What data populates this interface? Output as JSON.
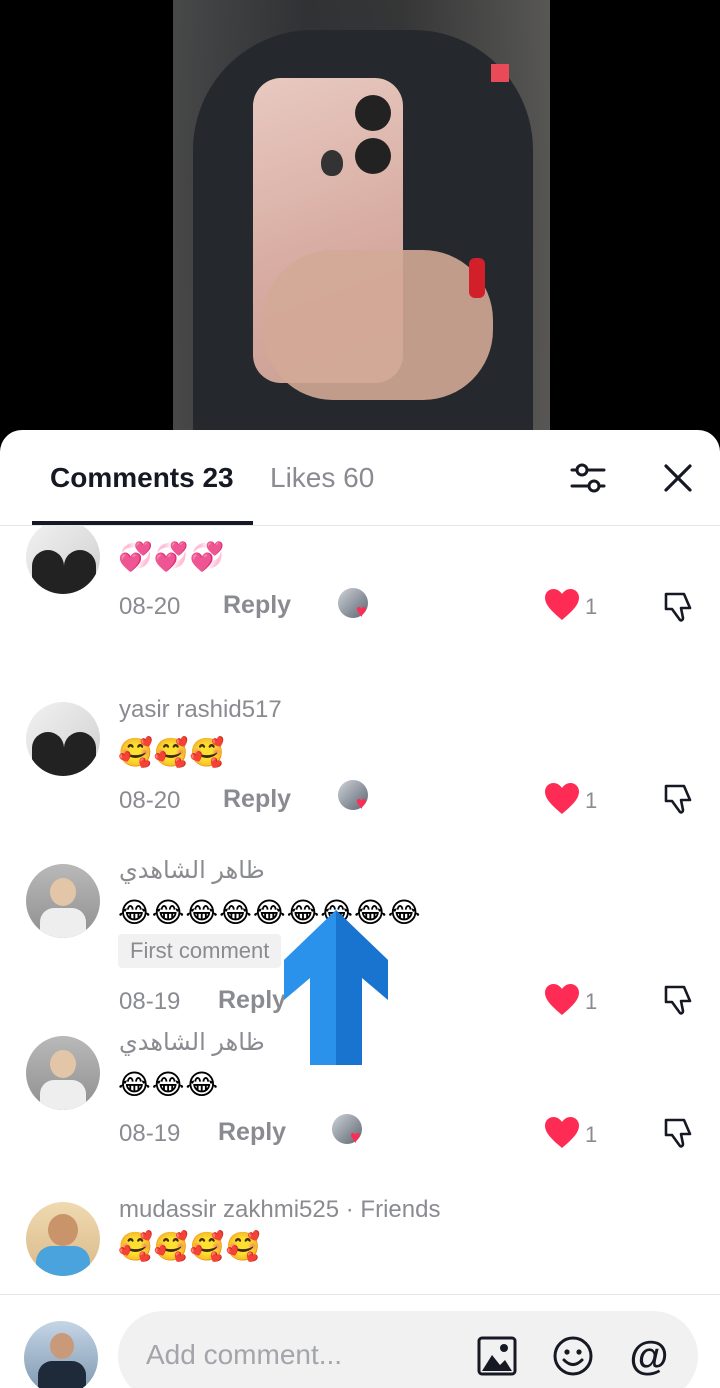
{
  "header": {
    "comments_tab": "Comments 23",
    "likes_tab": "Likes 60"
  },
  "comments": [
    {
      "username": "",
      "text": "💞💞💞",
      "date": "08-20",
      "reply": "Reply",
      "likes": "1",
      "creator_liked": true
    },
    {
      "username": "yasir rashid517",
      "text": "🥰🥰🥰",
      "date": "08-20",
      "reply": "Reply",
      "likes": "1",
      "creator_liked": true
    },
    {
      "username": "ظاهر الشاهدي",
      "text": "😂😂😂😂😂😂😂😂😂",
      "badge": "First comment",
      "date": "08-19",
      "reply": "Reply",
      "likes": "1",
      "creator_liked": false
    },
    {
      "username": "ظاهر الشاهدي",
      "text": "😂😂😂",
      "date": "08-19",
      "reply": "Reply",
      "likes": "1",
      "creator_liked": true
    },
    {
      "username": "mudassir zakhmi525 · Friends",
      "text": "🥰🥰🥰🥰",
      "date": "",
      "reply": "",
      "likes": "",
      "creator_liked": false
    }
  ],
  "input": {
    "placeholder": "Add comment..."
  },
  "icons": {
    "filter": "sliders-icon",
    "close": "close-icon",
    "like": "heart-icon",
    "dislike": "thumbs-down-icon",
    "image": "image-icon",
    "emoji": "smiley-icon",
    "mention": "at-icon",
    "overlay": "up-arrow-icon"
  },
  "colors": {
    "accent": "#fe2c55",
    "text_primary": "#161823",
    "text_secondary": "#8a8b91",
    "overlay_arrow": "#1e88e5"
  }
}
